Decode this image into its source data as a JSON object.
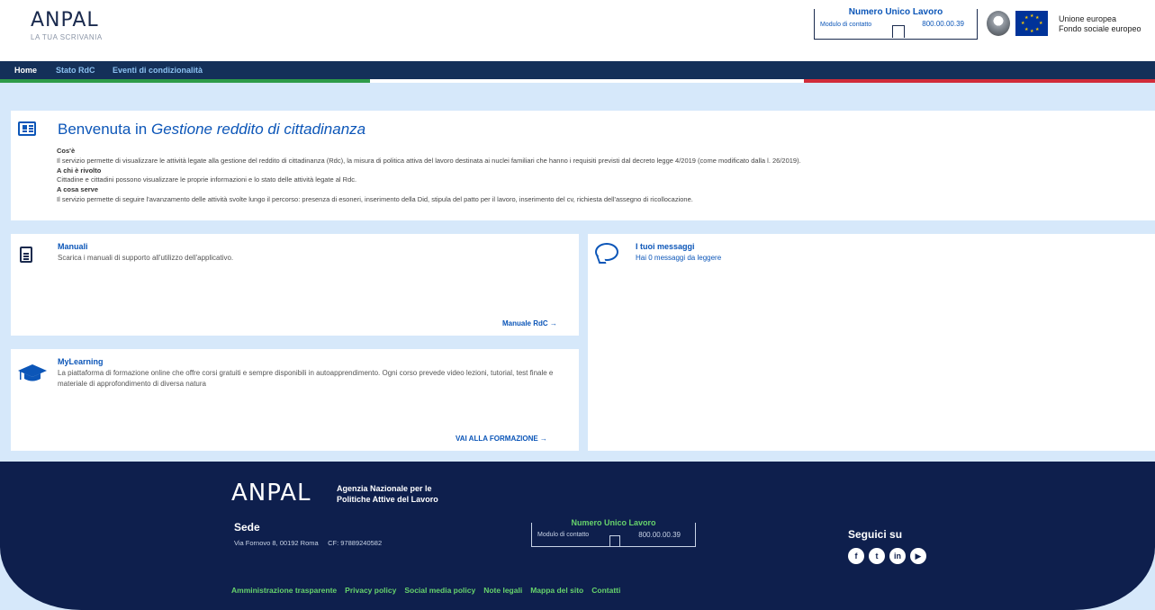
{
  "header": {
    "logo_text": "ANPAL",
    "logo_sub": "LA TUA SCRIVANIA",
    "nul_title": "Numero Unico Lavoro",
    "nul_left": "Modulo di contatto",
    "nul_number": "800.00.00.39",
    "eu_line1": "Unione europea",
    "eu_line2": "Fondo sociale europeo"
  },
  "nav": {
    "home": "Home",
    "stato": "Stato RdC",
    "eventi": "Eventi di condizionalità"
  },
  "welcome": {
    "title_prefix": "Benvenuta in ",
    "title_italic": "Gestione reddito di cittadinanza",
    "h_cose": "Cos'è",
    "p_cose": "Il servizio permette di visualizzare le attività legate alla gestione del reddito di cittadinanza (Rdc), la misura di politica attiva del lavoro destinata ai nuclei familiari che hanno i requisiti previsti dal decreto legge 4/2019 (come modificato dalla l. 26/2019).",
    "h_chi": "A chi è rivolto",
    "p_chi": "Cittadine e cittadini possono visualizzare le proprie informazioni e lo stato delle attività legate al Rdc.",
    "h_cosa": "A cosa serve",
    "p_cosa": "Il servizio permette di seguire l'avanzamento delle attività svolte lungo il percorso: presenza di esoneri, inserimento della Did, stipula del patto per il lavoro, inserimento del cv, richiesta dell'assegno di ricollocazione."
  },
  "manuali": {
    "title": "Manuali",
    "desc": "Scarica i manuali di supporto all'utilizzo dell'applicativo.",
    "link": "Manuale RdC"
  },
  "messaggi": {
    "title": "I tuoi messaggi",
    "desc": "Hai 0 messaggi da leggere"
  },
  "mylearning": {
    "title": "MyLearning",
    "desc": "La piattaforma di formazione online che offre corsi gratuiti e sempre disponibili in autoapprendimento. Ogni corso prevede video lezioni, tutorial, test finale e materiale di approfondimento di diversa natura",
    "link": "VAI ALLA FORMAZIONE"
  },
  "footer": {
    "logo": "ANPAL",
    "agency1": "Agenzia Nazionale per le",
    "agency2": "Politiche Attive del Lavoro",
    "sede": "Sede",
    "address": "Via Fornovo 8, 00192 Roma     CF: 97889240582",
    "nul_title": "Numero Unico Lavoro",
    "nul_left": "Modulo di contatto",
    "nul_number": "800.00.00.39",
    "seguici": "Seguici su",
    "links": [
      "Amministrazione trasparente",
      "Privacy policy",
      "Social media policy",
      "Note legali",
      "Mappa del sito",
      "Contatti"
    ]
  },
  "colors": {
    "brand_blue": "#0c56b8",
    "nav_bg": "#143059",
    "footer_bg": "#0e1f4d",
    "footer_link": "#67d36c"
  }
}
